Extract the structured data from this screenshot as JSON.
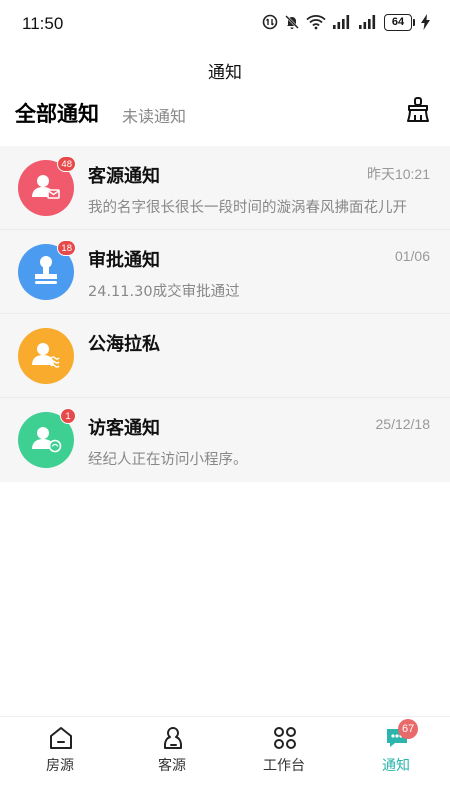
{
  "status_bar": {
    "time": "11:50",
    "battery": "64",
    "icons": [
      "data-saver-icon",
      "mute-icon",
      "wifi-icon",
      "signal-icon",
      "signal-icon",
      "battery-icon",
      "charging-icon"
    ]
  },
  "nav": {
    "title": "通知"
  },
  "tabs": {
    "all": "全部通知",
    "unread": "未读通知",
    "clear_icon": "broom-icon"
  },
  "notifications": [
    {
      "title": "客源通知",
      "time": "昨天10:21",
      "subtitle": "我的名字很长很长一段时间的漩涡春风拂面花儿开",
      "badge": "48",
      "color": "#f05a6c",
      "icon": "customer-mail-icon"
    },
    {
      "title": "审批通知",
      "time": "01/06",
      "subtitle": "24.11.30成交审批通过",
      "badge": "18",
      "color": "#4b9cf0",
      "icon": "stamp-icon"
    },
    {
      "title": "公海拉私",
      "time": "",
      "subtitle": "",
      "badge": "",
      "color": "#f8ab2d",
      "icon": "user-wave-icon"
    },
    {
      "title": "访客通知",
      "time": "25/12/18",
      "subtitle": "经纪人正在访问小程序。",
      "badge": "1",
      "color": "#3ecf93",
      "icon": "visitor-icon"
    }
  ],
  "bottom_nav": {
    "items": [
      {
        "label": "房源",
        "icon": "house-icon"
      },
      {
        "label": "客源",
        "icon": "person-icon"
      },
      {
        "label": "工作台",
        "icon": "grid-icon"
      },
      {
        "label": "通知",
        "icon": "chat-icon",
        "badge": "67"
      }
    ],
    "active_color": "#2bb5ad"
  }
}
